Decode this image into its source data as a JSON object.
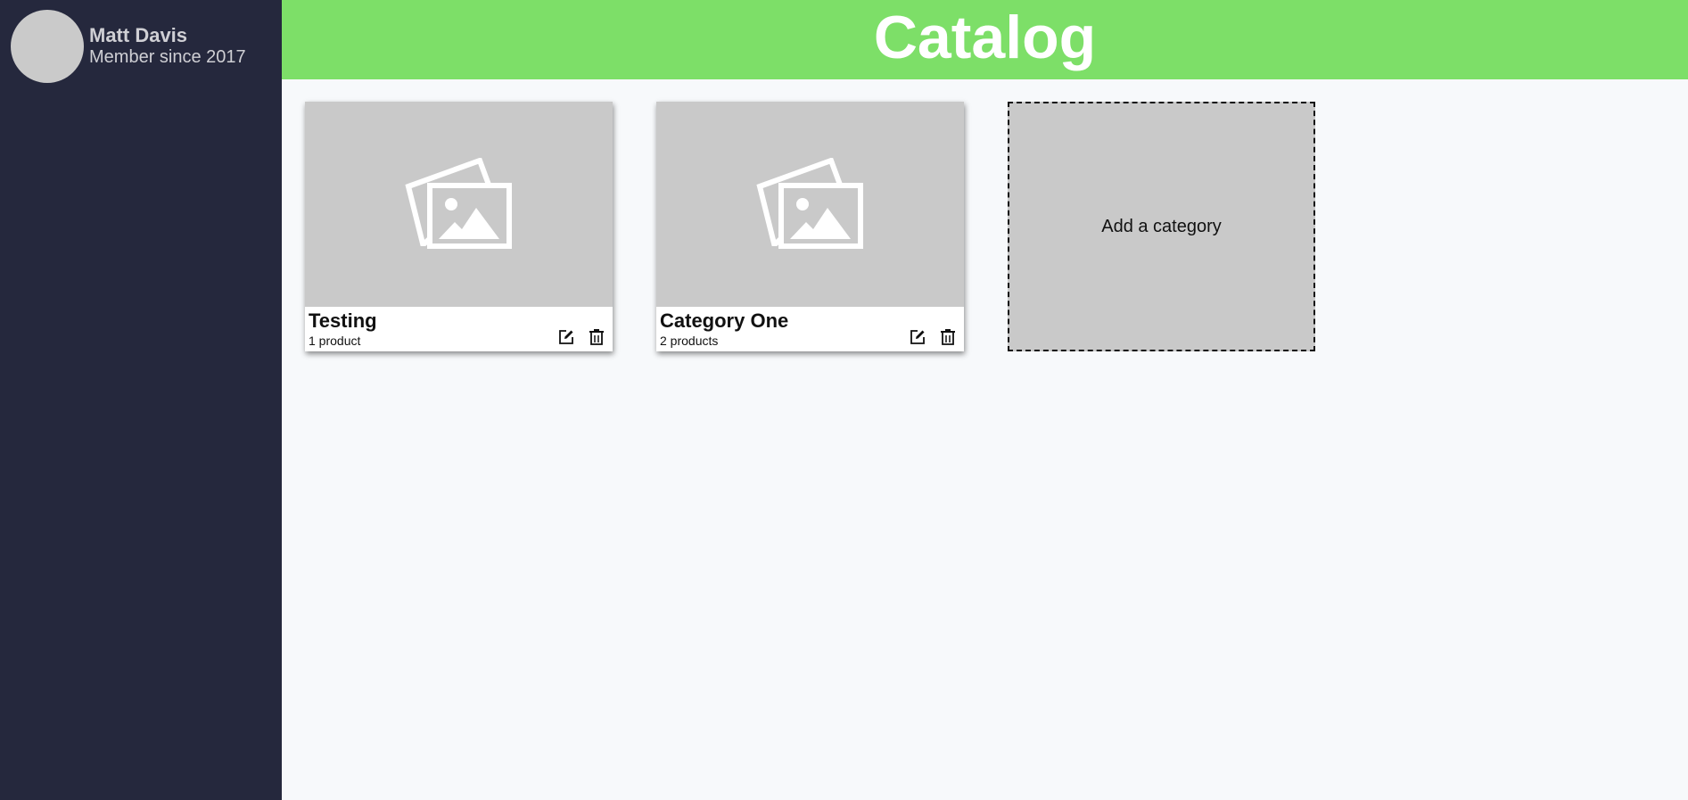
{
  "user": {
    "name": "Matt Davis",
    "member_since": "Member since 2017"
  },
  "header": {
    "title": "Catalog"
  },
  "categories": [
    {
      "title": "Testing",
      "count": "1 product"
    },
    {
      "title": "Category One",
      "count": "2 products"
    }
  ],
  "add_category": {
    "label": "Add a category"
  },
  "icons": {
    "image_placeholder": "image-placeholder-icon",
    "edit": "edit-icon",
    "delete": "trash-icon"
  },
  "colors": {
    "sidebar": "#25283d",
    "header": "#7ddf68",
    "placeholder": "#c9c9c9"
  }
}
